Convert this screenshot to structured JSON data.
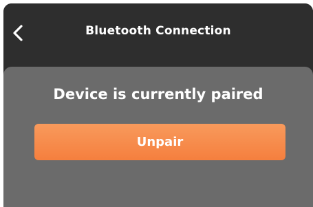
{
  "header": {
    "title": "Bluetooth Connection",
    "back_icon": "chevron-left-icon"
  },
  "main": {
    "status_text": "Device is currently paired",
    "unpair_label": "Unpair"
  },
  "colors": {
    "header_bg": "#2e2e2e",
    "panel_bg": "#6b6b6b",
    "accent": "#f68a4b",
    "text": "#ffffff"
  }
}
